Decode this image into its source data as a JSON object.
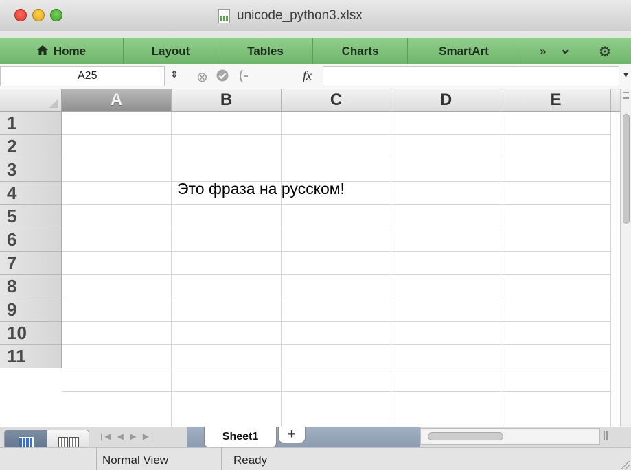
{
  "window": {
    "title": "unicode_python3.xlsx",
    "file_icon": "xlsx-document-icon"
  },
  "ribbon": {
    "tabs": [
      {
        "label": "Home",
        "icon": "home-icon"
      },
      {
        "label": "Layout"
      },
      {
        "label": "Tables"
      },
      {
        "label": "Charts"
      },
      {
        "label": "SmartArt"
      }
    ],
    "more_glyph": "»",
    "menu_glyph": "⌄",
    "settings_glyph": "⚙"
  },
  "formula_bar": {
    "name_box": "A25",
    "stepper_glyph": "⇕",
    "cancel_glyph": "⊗",
    "confirm_glyph": "✓",
    "formula_glyph": "fx",
    "value": ""
  },
  "sheet": {
    "columns": [
      "A",
      "B",
      "C",
      "D",
      "E"
    ],
    "selected_column": "A",
    "rows": [
      "1",
      "2",
      "3",
      "4",
      "5",
      "6",
      "7",
      "8",
      "9",
      "10",
      "11"
    ],
    "cell_B3": "Это фраза на русском!"
  },
  "sheet_tabs": {
    "nav_glyphs": "|◀ ◀ ▶ ▶|",
    "tabs": [
      {
        "label": "Sheet1",
        "active": true
      }
    ],
    "add_glyph": "+"
  },
  "status": {
    "view_mode": "Normal View",
    "state": "Ready"
  }
}
